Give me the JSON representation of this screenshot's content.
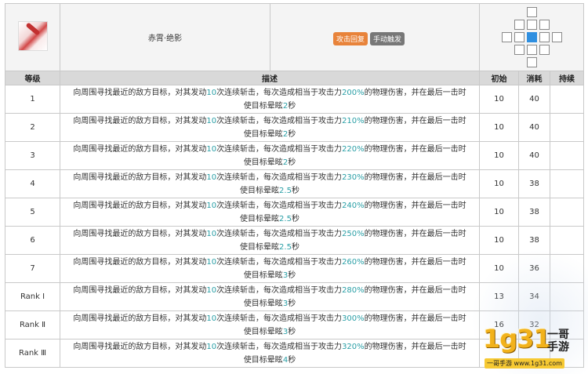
{
  "skill": {
    "name": "赤霄·绝影",
    "tags": [
      "攻击回复",
      "手动触发"
    ]
  },
  "range": {
    "rows": [
      [
        0,
        0,
        1,
        0,
        0
      ],
      [
        0,
        1,
        1,
        1,
        0
      ],
      [
        1,
        1,
        2,
        1,
        1
      ],
      [
        0,
        1,
        1,
        1,
        0
      ],
      [
        0,
        0,
        1,
        0,
        0
      ]
    ]
  },
  "columns": {
    "level": "等级",
    "desc": "描述",
    "initial": "初始",
    "cost": "消耗",
    "duration": "持续"
  },
  "rows": [
    {
      "level": "1",
      "desc_a": "向周围寻找最近的敌方目标，对其发动",
      "hits": "10",
      "desc_b": "次连续斩击，每次造成相当于攻击力",
      "pct": "200%",
      "desc_c": "的物理伤害，并在最后一击时",
      "desc_d": "使目标晕眩",
      "stun": "2",
      "desc_e": "秒",
      "initial": "10",
      "cost": "40",
      "duration": ""
    },
    {
      "level": "2",
      "desc_a": "向周围寻找最近的敌方目标，对其发动",
      "hits": "10",
      "desc_b": "次连续斩击，每次造成相当于攻击力",
      "pct": "210%",
      "desc_c": "的物理伤害，并在最后一击时",
      "desc_d": "使目标晕眩",
      "stun": "2",
      "desc_e": "秒",
      "initial": "10",
      "cost": "40",
      "duration": ""
    },
    {
      "level": "3",
      "desc_a": "向周围寻找最近的敌方目标，对其发动",
      "hits": "10",
      "desc_b": "次连续斩击，每次造成相当于攻击力",
      "pct": "220%",
      "desc_c": "的物理伤害，并在最后一击时",
      "desc_d": "使目标晕眩",
      "stun": "2",
      "desc_e": "秒",
      "initial": "10",
      "cost": "40",
      "duration": ""
    },
    {
      "level": "4",
      "desc_a": "向周围寻找最近的敌方目标，对其发动",
      "hits": "10",
      "desc_b": "次连续斩击，每次造成相当于攻击力",
      "pct": "230%",
      "desc_c": "的物理伤害，并在最后一击时",
      "desc_d": "使目标晕眩",
      "stun": "2.5",
      "desc_e": "秒",
      "initial": "10",
      "cost": "38",
      "duration": ""
    },
    {
      "level": "5",
      "desc_a": "向周围寻找最近的敌方目标，对其发动",
      "hits": "10",
      "desc_b": "次连续斩击，每次造成相当于攻击力",
      "pct": "240%",
      "desc_c": "的物理伤害，并在最后一击时",
      "desc_d": "使目标晕眩",
      "stun": "2.5",
      "desc_e": "秒",
      "initial": "10",
      "cost": "38",
      "duration": ""
    },
    {
      "level": "6",
      "desc_a": "向周围寻找最近的敌方目标，对其发动",
      "hits": "10",
      "desc_b": "次连续斩击，每次造成相当于攻击力",
      "pct": "250%",
      "desc_c": "的物理伤害，并在最后一击时",
      "desc_d": "使目标晕眩",
      "stun": "2.5",
      "desc_e": "秒",
      "initial": "10",
      "cost": "38",
      "duration": ""
    },
    {
      "level": "7",
      "desc_a": "向周围寻找最近的敌方目标，对其发动",
      "hits": "10",
      "desc_b": "次连续斩击，每次造成相当于攻击力",
      "pct": "260%",
      "desc_c": "的物理伤害，并在最后一击时",
      "desc_d": "使目标晕眩",
      "stun": "3",
      "desc_e": "秒",
      "initial": "10",
      "cost": "36",
      "duration": ""
    },
    {
      "level": "Rank Ⅰ",
      "desc_a": "向周围寻找最近的敌方目标，对其发动",
      "hits": "10",
      "desc_b": "次连续斩击，每次造成相当于攻击力",
      "pct": "280%",
      "desc_c": "的物理伤害，并在最后一击时",
      "desc_d": "使目标晕眩",
      "stun": "3",
      "desc_e": "秒",
      "initial": "13",
      "cost": "34",
      "duration": ""
    },
    {
      "level": "Rank Ⅱ",
      "desc_a": "向周围寻找最近的敌方目标，对其发动",
      "hits": "10",
      "desc_b": "次连续斩击，每次造成相当于攻击力",
      "pct": "300%",
      "desc_c": "的物理伤害，并在最后一击时",
      "desc_d": "使目标晕眩",
      "stun": "3",
      "desc_e": "秒",
      "initial": "16",
      "cost": "32",
      "duration": ""
    },
    {
      "level": "Rank Ⅲ",
      "desc_a": "向周围寻找最近的敌方目标，对其发动",
      "hits": "10",
      "desc_b": "次连续斩击，每次造成相当于攻击力",
      "pct": "320%",
      "desc_c": "的物理伤害，并在最后一击时",
      "desc_d": "使目标晕眩",
      "stun": "4",
      "desc_e": "秒",
      "initial": "",
      "cost": "",
      "duration": ""
    }
  ],
  "watermark": {
    "logo_text": "1g31",
    "brand": "一哥手游",
    "url": "一哥手游 www.1g31.com"
  },
  "colors": {
    "highlight": "#2a9fa6",
    "range_self": "#2f8fe0",
    "tag_orange": "#e8833a",
    "tag_gray": "#777777"
  }
}
